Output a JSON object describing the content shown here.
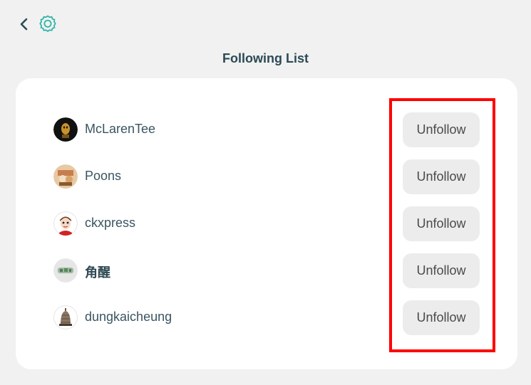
{
  "header": {
    "back_icon": "chevron-left-icon",
    "settings_icon": "gear-icon",
    "accent_color": "#2fb5a6"
  },
  "page": {
    "title": "Following List"
  },
  "following": [
    {
      "username": "McLarenTee",
      "avatar_icon": "avatar-icon",
      "action_label": "Unfollow"
    },
    {
      "username": "Poons",
      "avatar_icon": "avatar-icon",
      "action_label": "Unfollow"
    },
    {
      "username": "ckxpress",
      "avatar_icon": "avatar-icon",
      "action_label": "Unfollow"
    },
    {
      "username": "角醒",
      "avatar_icon": "avatar-icon",
      "action_label": "Unfollow"
    },
    {
      "username": "dungkaicheung",
      "avatar_icon": "avatar-icon",
      "action_label": "Unfollow"
    }
  ],
  "highlight": {
    "color": "#ff0000"
  }
}
